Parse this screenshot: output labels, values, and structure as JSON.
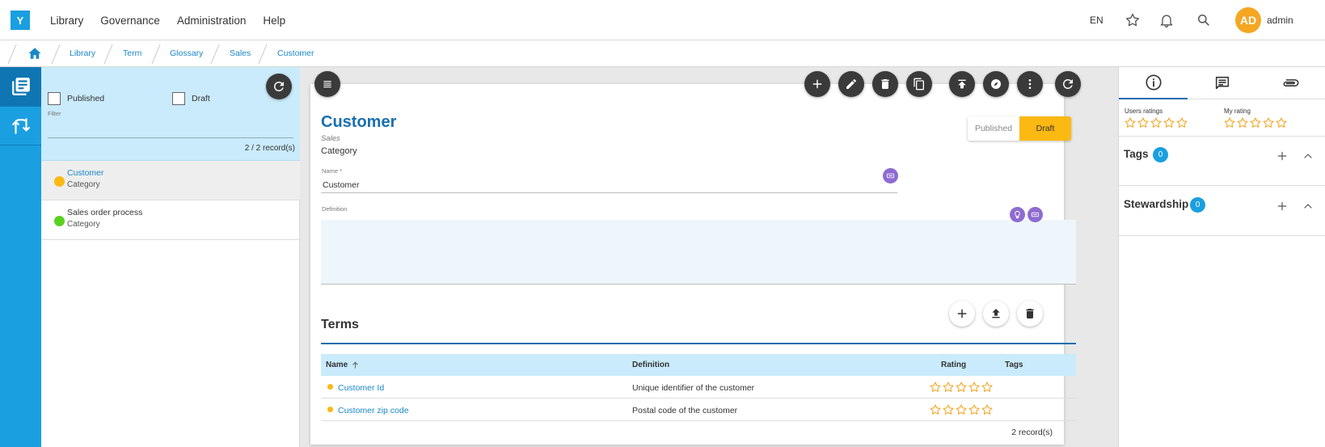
{
  "app": {
    "logo": "Y"
  },
  "topnav": [
    "Library",
    "Governance",
    "Administration",
    "Help"
  ],
  "topbar": {
    "language": "EN",
    "avatar_initials": "AD",
    "username": "admin"
  },
  "breadcrumb": [
    "Library",
    "Term",
    "Glossary",
    "Sales",
    "Customer"
  ],
  "filters": {
    "published_label": "Published",
    "draft_label": "Draft",
    "filter_label": "Filter",
    "records": "2 / 2 record(s)"
  },
  "list": [
    {
      "title": "Customer",
      "subtitle": "Category",
      "color": "#fcb813"
    },
    {
      "title": "Sales order process",
      "subtitle": "Category",
      "color": "#5cd01f"
    }
  ],
  "detail": {
    "title": "Customer",
    "subtitle": "Sales",
    "type": "Category",
    "status_published": "Published",
    "status_draft": "Draft",
    "name_label": "Name *",
    "name_value": "Customer",
    "definition_label": "Definition",
    "definition_value": ""
  },
  "terms": {
    "title": "Terms",
    "columns": {
      "name": "Name",
      "definition": "Definition",
      "rating": "Rating",
      "tags": "Tags"
    },
    "rows": [
      {
        "name": "Customer Id",
        "definition": "Unique identifier of the customer",
        "rating": 0
      },
      {
        "name": "Customer zip code",
        "definition": "Postal code of the customer",
        "rating": 0
      }
    ],
    "count": "2 record(s)"
  },
  "right": {
    "users_ratings_label": "Users ratings",
    "my_rating_label": "My rating",
    "tags_title": "Tags",
    "tags_count": "0",
    "stewardship_title": "Stewardship",
    "stewardship_count": "0"
  },
  "colors": {
    "accent": "#1a9fe0",
    "dark_accent": "#1a6fae",
    "draft": "#fcb813",
    "star": "#f5a623"
  }
}
